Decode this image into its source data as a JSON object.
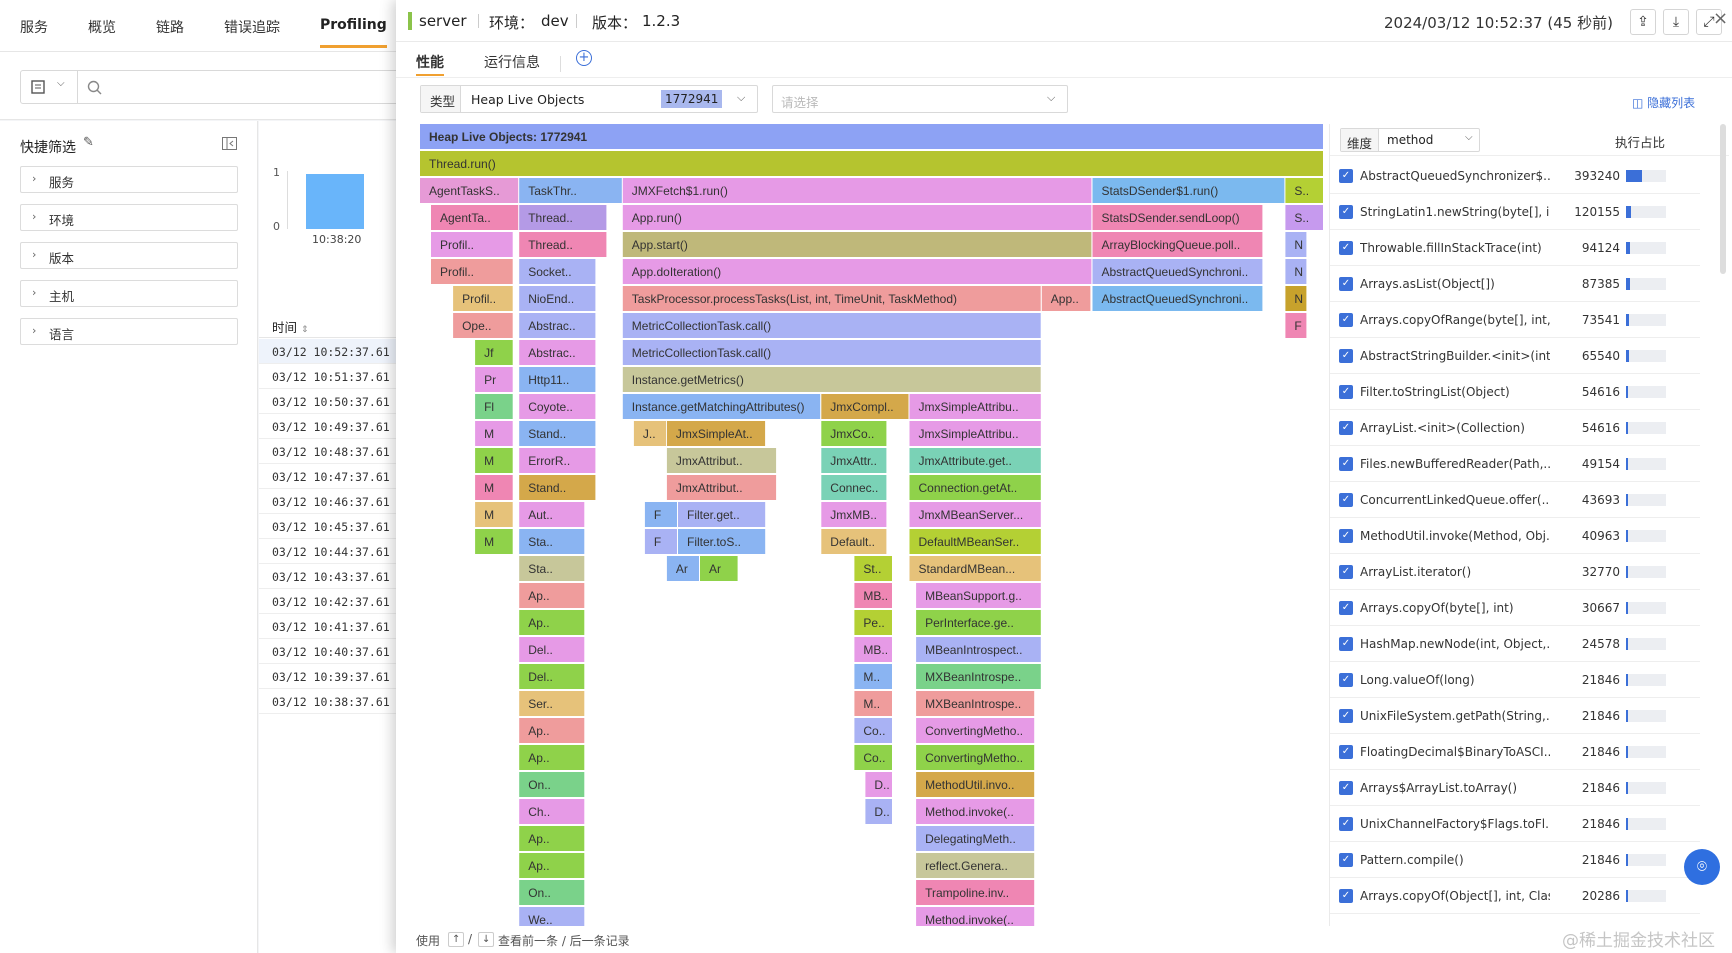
{
  "topnav": {
    "tabs": [
      "服务",
      "概览",
      "链路",
      "错误追踪",
      "Profiling"
    ],
    "active": "Profiling"
  },
  "quick_filter": {
    "title": "快捷筛选",
    "items": [
      "服务",
      "环境",
      "版本",
      "主机",
      "语言"
    ]
  },
  "mini_chart": {
    "y_ticks": [
      "1",
      "0"
    ],
    "x_label": "10:38:20",
    "bar_color": "#69b5fa",
    "value": 1
  },
  "time_table": {
    "header": "时间",
    "rows": [
      "03/12 10:52:37.61",
      "03/12 10:51:37.61",
      "03/12 10:50:37.61",
      "03/12 10:49:37.61",
      "03/12 10:48:37.61",
      "03/12 10:47:37.61",
      "03/12 10:46:37.61",
      "03/12 10:45:37.61",
      "03/12 10:44:37.61",
      "03/12 10:43:37.61",
      "03/12 10:42:37.61",
      "03/12 10:41:37.61",
      "03/12 10:40:37.61",
      "03/12 10:39:37.61",
      "03/12 10:38:37.61"
    ]
  },
  "drawer": {
    "service": "server",
    "env_label": "环境：",
    "env": "dev",
    "version_label": "版本：",
    "version": "1.2.3",
    "timestamp": "2024/03/12 10:52:37 (45 秒前)",
    "accent": "#8bc34a",
    "tabs": [
      "性能",
      "运行信息"
    ],
    "active_tab": "性能",
    "type_label": "类型",
    "type_value": "Heap Live Objects",
    "type_count": "1772941",
    "select_placeholder": "请选择",
    "hide_list": "隐藏列表",
    "footer": {
      "prefix": "使用",
      "up": "↑",
      "sep": "/",
      "down": "↓",
      "suffix": "查看前一条 / 后一条记录"
    }
  },
  "flame": {
    "rows": [
      [
        [
          "Heap Live Objects: 1772941",
          0,
          820,
          "#8da2f4",
          true
        ]
      ],
      [
        [
          "Thread.run()",
          0,
          820,
          "#b5c42f"
        ]
      ],
      [
        [
          "AgentTaskS..",
          0,
          90,
          "#e69ad6"
        ],
        [
          "TaskThr..",
          90,
          94,
          "#8ab4f2"
        ],
        [
          "JMXFetch$1.run()",
          184,
          426,
          "#e69ae6"
        ],
        [
          "StatsDSender$1.run()",
          610,
          175,
          "#7bb9ef"
        ],
        [
          "S..",
          785,
          35,
          "#b4d034"
        ]
      ],
      [
        [
          "AgentTa..",
          10,
          80,
          "#ef86b3"
        ],
        [
          "Thread..",
          90,
          80,
          "#b49ae6"
        ],
        [
          "App.run()",
          184,
          426,
          "#e69ae6"
        ],
        [
          "StatsDSender.sendLoop()",
          610,
          155,
          "#ef86b3"
        ],
        [
          "S..",
          785,
          35,
          "#c69aee"
        ]
      ],
      [
        [
          "Profil..",
          10,
          75,
          "#e69ae6"
        ],
        [
          "Thread..",
          90,
          80,
          "#ef86b3"
        ],
        [
          "App.start()",
          184,
          426,
          "#bfb87a"
        ],
        [
          "ArrayBlockingQueue.poll..",
          610,
          155,
          "#ef86b3"
        ],
        [
          "N",
          785,
          20,
          "#a9b2f4"
        ]
      ],
      [
        [
          "Profil..",
          10,
          75,
          "#ef9c9c"
        ],
        [
          "Socket..",
          90,
          70,
          "#a9b2f4"
        ],
        [
          "App.doIteration()",
          184,
          426,
          "#e69ae6"
        ],
        [
          "AbstractQueuedSynchroni..",
          610,
          155,
          "#a9b2f4"
        ],
        [
          "N",
          785,
          20,
          "#a9b2f4"
        ]
      ],
      [
        [
          "Profil..",
          30,
          55,
          "#e6c27a"
        ],
        [
          "NioEnd..",
          90,
          70,
          "#a9b2f4"
        ],
        [
          "TaskProcessor.processTasks(List, int, TimeUnit, TaskMethod)",
          184,
          380,
          "#ef9c9c"
        ],
        [
          "App..",
          564,
          45,
          "#ef9c9c"
        ],
        [
          "AbstractQueuedSynchroni..",
          610,
          155,
          "#7bb9ef"
        ],
        [
          "N",
          785,
          20,
          "#c7a22c"
        ]
      ],
      [
        [
          "Ope..",
          30,
          55,
          "#ef9c9c"
        ],
        [
          "Abstrac..",
          90,
          70,
          "#a9b2f4"
        ],
        [
          "MetricCollectionTask.call()",
          184,
          380,
          "#a9b2f4"
        ],
        [
          "F",
          785,
          20,
          "#ef86b3"
        ]
      ],
      [
        [
          "Jf",
          50,
          35,
          "#8fd24a"
        ],
        [
          "Abstrac..",
          90,
          70,
          "#e69ae6"
        ],
        [
          "MetricCollectionTask.call()",
          184,
          380,
          "#a9b2f4"
        ]
      ],
      [
        [
          "Pr",
          50,
          35,
          "#e69ae6"
        ],
        [
          "Http11..",
          90,
          70,
          "#8ab4f2"
        ],
        [
          "Instance.getMetrics()",
          184,
          380,
          "#c7c79a"
        ]
      ],
      [
        [
          "Fl",
          50,
          35,
          "#7ad28a"
        ],
        [
          "Coyote..",
          90,
          70,
          "#e69ae6"
        ],
        [
          "Instance.getMatchingAttributes()",
          184,
          180,
          "#8ab4f2"
        ],
        [
          "JmxCompl..",
          364,
          80,
          "#d4a84a"
        ],
        [
          "JmxSimpleAttribu..",
          444,
          120,
          "#e69ae6"
        ]
      ],
      [
        [
          "M",
          50,
          35,
          "#e69ae6"
        ],
        [
          "Stand..",
          90,
          70,
          "#8ab4f2"
        ],
        [
          "J..",
          194,
          30,
          "#e6c27a"
        ],
        [
          "JmxSimpleAt..",
          224,
          90,
          "#d4a84a"
        ],
        [
          "JmxCo..",
          364,
          60,
          "#8fd24a"
        ],
        [
          "JmxSimpleAttribu..",
          444,
          120,
          "#e69ae6"
        ]
      ],
      [
        [
          "M",
          50,
          35,
          "#8fd24a"
        ],
        [
          "ErrorR..",
          90,
          70,
          "#e69ae6"
        ],
        [
          "JmxAttribut..",
          224,
          100,
          "#c7c79a"
        ],
        [
          "JmxAttr..",
          364,
          60,
          "#7ad2b6"
        ],
        [
          "JmxAttribute.get..",
          444,
          120,
          "#7ad2b6"
        ]
      ],
      [
        [
          "M",
          50,
          35,
          "#ef86b3"
        ],
        [
          "Stand..",
          90,
          70,
          "#d4a84a"
        ],
        [
          "JmxAttribut..",
          224,
          100,
          "#ef9c9c"
        ],
        [
          "Connec..",
          364,
          60,
          "#7ad2b6"
        ],
        [
          "Connection.getAt..",
          444,
          120,
          "#8fd24a"
        ]
      ],
      [
        [
          "M",
          50,
          35,
          "#e6c27a"
        ],
        [
          "Aut..",
          90,
          60,
          "#e69ae6"
        ],
        [
          "F",
          204,
          30,
          "#8ab4f2"
        ],
        [
          "Filter.get..",
          234,
          80,
          "#a9b2f4"
        ],
        [
          "JmxMB..",
          364,
          60,
          "#e69ae6"
        ],
        [
          "JmxMBeanServer...",
          444,
          120,
          "#e69ae6"
        ]
      ],
      [
        [
          "M",
          50,
          35,
          "#8fd24a"
        ],
        [
          "Sta..",
          90,
          60,
          "#8ab4f2"
        ],
        [
          "F",
          204,
          30,
          "#a9b2f4"
        ],
        [
          "Filter.toS..",
          234,
          80,
          "#8ab4f2"
        ],
        [
          "Default..",
          364,
          60,
          "#e6c27a"
        ],
        [
          "DefaultMBeanSer..",
          444,
          120,
          "#b4d034"
        ]
      ],
      [
        [
          "Sta..",
          90,
          60,
          "#c7c79a"
        ],
        [
          "Ar",
          224,
          30,
          "#8ab4f2"
        ],
        [
          "Ar",
          254,
          35,
          "#8fd24a"
        ],
        [
          "St..",
          394,
          35,
          "#b4d034"
        ],
        [
          "StandardMBean...",
          444,
          120,
          "#e6c27a"
        ]
      ],
      [
        [
          "Ap..",
          90,
          60,
          "#ef9c9c"
        ],
        [
          "MB..",
          394,
          35,
          "#ef86b3"
        ],
        [
          "MBeanSupport.g..",
          450,
          114,
          "#e69ae6"
        ]
      ],
      [
        [
          "Ap..",
          90,
          60,
          "#8fd24a"
        ],
        [
          "Pe..",
          394,
          35,
          "#b4d034"
        ],
        [
          "PerInterface.ge..",
          450,
          114,
          "#8fd24a"
        ]
      ],
      [
        [
          "Del..",
          90,
          60,
          "#e69ae6"
        ],
        [
          "MB..",
          394,
          35,
          "#e69ae6"
        ],
        [
          "MBeanIntrospect..",
          450,
          114,
          "#a9b2f4"
        ]
      ],
      [
        [
          "Del..",
          90,
          60,
          "#8fd24a"
        ],
        [
          "M..",
          394,
          35,
          "#8ab4f2"
        ],
        [
          "MXBeanIntrospe..",
          450,
          114,
          "#7ad28a"
        ]
      ],
      [
        [
          "Ser..",
          90,
          60,
          "#e6c27a"
        ],
        [
          "M..",
          394,
          35,
          "#ef9c9c"
        ],
        [
          "MXBeanIntrospe..",
          450,
          108,
          "#ef9c9c"
        ]
      ],
      [
        [
          "Ap..",
          90,
          60,
          "#ef9c9c"
        ],
        [
          "Co..",
          394,
          35,
          "#a9b2f4"
        ],
        [
          "ConvertingMetho..",
          450,
          108,
          "#e69ae6"
        ]
      ],
      [
        [
          "Ap..",
          90,
          60,
          "#8fd24a"
        ],
        [
          "Co..",
          394,
          35,
          "#8fd24a"
        ],
        [
          "ConvertingMetho..",
          450,
          108,
          "#8fd24a"
        ]
      ],
      [
        [
          "On..",
          90,
          60,
          "#7ad28a"
        ],
        [
          "D..",
          404,
          25,
          "#e69ae6"
        ],
        [
          "MethodUtil.invo..",
          450,
          108,
          "#d4a84a"
        ]
      ],
      [
        [
          "Ch..",
          90,
          60,
          "#e69ae6"
        ],
        [
          "D..",
          404,
          25,
          "#a9b2f4"
        ],
        [
          "Method.invoke(..",
          450,
          108,
          "#e69ae6"
        ]
      ],
      [
        [
          "Ap..",
          90,
          60,
          "#8fd24a"
        ],
        [
          "DelegatingMeth..",
          450,
          108,
          "#a9b2f4"
        ]
      ],
      [
        [
          "Ap..",
          90,
          60,
          "#8fd24a"
        ],
        [
          "reflect.Genera..",
          450,
          108,
          "#c7c79a"
        ]
      ],
      [
        [
          "On..",
          90,
          60,
          "#7ad28a"
        ],
        [
          "Trampoline.inv..",
          450,
          108,
          "#ef86b3"
        ]
      ],
      [
        [
          "We..",
          90,
          60,
          "#a9b2f4"
        ],
        [
          "Method.invoke(..",
          450,
          108,
          "#e69ae6"
        ]
      ]
    ]
  },
  "dim": {
    "label": "维度",
    "value": "method",
    "ratio_label": "执行占比",
    "rows": [
      {
        "name": "AbstractQueuedSynchronizer$...",
        "value": "393240",
        "pct": 0.22
      },
      {
        "name": "StringLatin1.newString(byte[], i...",
        "value": "120155",
        "pct": 0.068
      },
      {
        "name": "Throwable.fillInStackTrace(int)",
        "value": "94124",
        "pct": 0.053
      },
      {
        "name": "Arrays.asList(Object[])",
        "value": "87385",
        "pct": 0.049
      },
      {
        "name": "Arrays.copyOfRange(byte[], int,...",
        "value": "73541",
        "pct": 0.041
      },
      {
        "name": "AbstractStringBuilder.<init>(int)",
        "value": "65540",
        "pct": 0.037
      },
      {
        "name": "Filter.toStringList(Object)",
        "value": "54616",
        "pct": 0.031
      },
      {
        "name": "ArrayList.<init>(Collection)",
        "value": "54616",
        "pct": 0.031
      },
      {
        "name": "Files.newBufferedReader(Path,...",
        "value": "49154",
        "pct": 0.028
      },
      {
        "name": "ConcurrentLinkedQueue.offer(...",
        "value": "43693",
        "pct": 0.025
      },
      {
        "name": "MethodUtil.invoke(Method, Obj...",
        "value": "40963",
        "pct": 0.023
      },
      {
        "name": "ArrayList.iterator()",
        "value": "32770",
        "pct": 0.018
      },
      {
        "name": "Arrays.copyOf(byte[], int)",
        "value": "30667",
        "pct": 0.017
      },
      {
        "name": "HashMap.newNode(int, Object,...",
        "value": "24578",
        "pct": 0.014
      },
      {
        "name": "Long.valueOf(long)",
        "value": "21846",
        "pct": 0.012
      },
      {
        "name": "UnixFileSystem.getPath(String,...",
        "value": "21846",
        "pct": 0.012
      },
      {
        "name": "FloatingDecimal$BinaryToASCI...",
        "value": "21846",
        "pct": 0.012
      },
      {
        "name": "Arrays$ArrayList.toArray()",
        "value": "21846",
        "pct": 0.012
      },
      {
        "name": "UnixChannelFactory$Flags.toFl...",
        "value": "21846",
        "pct": 0.012
      },
      {
        "name": "Pattern.compile()",
        "value": "21846",
        "pct": 0.012
      },
      {
        "name": "Arrays.copyOf(Object[], int, Class)",
        "value": "20286",
        "pct": 0.011
      }
    ]
  },
  "watermark": "@稀土掘金技术社区"
}
